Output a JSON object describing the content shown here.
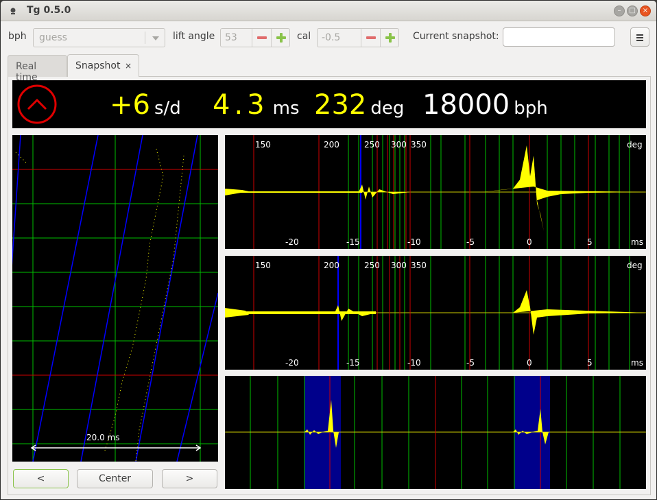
{
  "window": {
    "title": "Tg 0.5.0"
  },
  "toolbar": {
    "bph_label": "bph",
    "bph_value": "guess",
    "lift_angle_label": "lift angle",
    "lift_angle_value": "53",
    "cal_label": "cal",
    "cal_value": "-0.5",
    "snapshot_label": "Current snapshot:",
    "snapshot_value": "",
    "menu_icon": "hamburger-menu-icon"
  },
  "tabs": [
    {
      "label": "Real time"
    },
    {
      "label": "Snapshot",
      "close": "×"
    }
  ],
  "readout": {
    "rate_value": "+6",
    "rate_unit": "s/d",
    "beat_error_value": "4.3",
    "beat_error_unit": "ms",
    "amplitude_value": "232",
    "amplitude_unit": "deg",
    "bph_value": "18000",
    "bph_unit": "bph"
  },
  "waveform_axes": {
    "deg_ticks": [
      "150",
      "200",
      "250",
      "300",
      "350"
    ],
    "deg_unit": "deg",
    "ms_ticks": [
      "-20",
      "-15",
      "-10",
      "-5",
      "0",
      "5"
    ],
    "ms_unit": "ms"
  },
  "paperstrip": {
    "scale_label": "20.0 ms"
  },
  "nav": {
    "prev_label": "<",
    "center_label": "Center",
    "next_label": ">"
  },
  "colors": {
    "signal": "#ffff00",
    "grid_green": "#00c000",
    "grid_red": "#d00000",
    "marker_blue": "#0000ff",
    "highlight_blue": "#00008b"
  }
}
